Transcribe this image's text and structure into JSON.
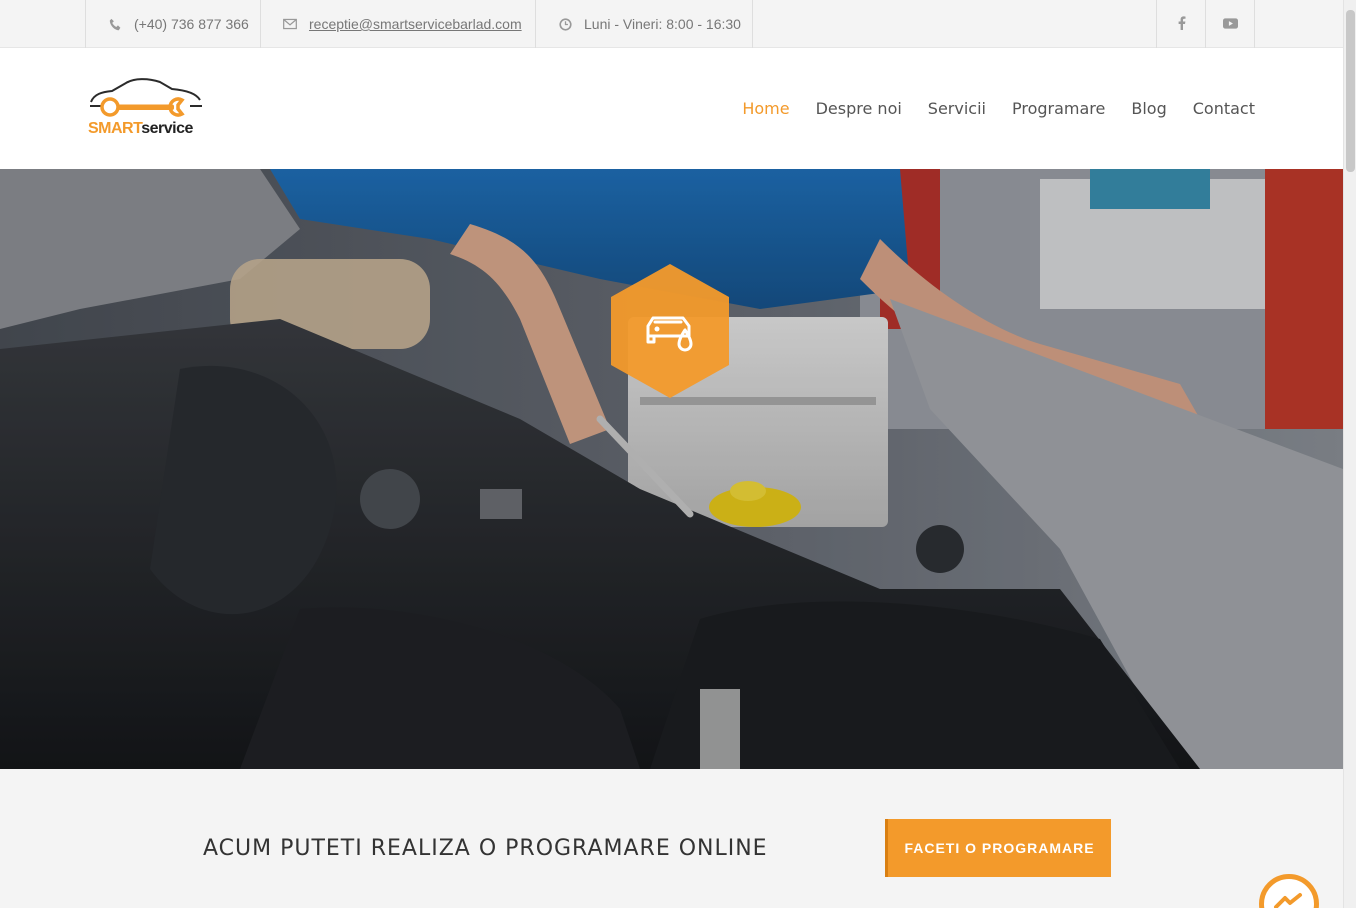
{
  "topbar": {
    "phone": "(+40) 736 877 366",
    "email": "receptie@smartservicebarlad.com",
    "hours": "Luni - Vineri: 8:00 - 16:30",
    "icons": [
      "phone-icon",
      "mail-icon",
      "clock-icon",
      "facebook-icon",
      "youtube-icon"
    ]
  },
  "logo": {
    "smart": "SMART",
    "service": "service"
  },
  "nav": {
    "items": [
      {
        "label": "Home",
        "active": true
      },
      {
        "label": "Despre noi"
      },
      {
        "label": "Servicii"
      },
      {
        "label": "Programare"
      },
      {
        "label": "Blog"
      },
      {
        "label": "Contact"
      }
    ]
  },
  "hero": {
    "badge_icon": "car-oil-icon"
  },
  "cta": {
    "text": "ACUM PUTETI REALIZA O PROGRAMARE ONLINE",
    "button_label": "FACETI O PROGRAMARE"
  },
  "colors": {
    "accent": "#f39a2b",
    "header_bg": "#ffffff",
    "topbar_bg": "#f4f4f4"
  }
}
